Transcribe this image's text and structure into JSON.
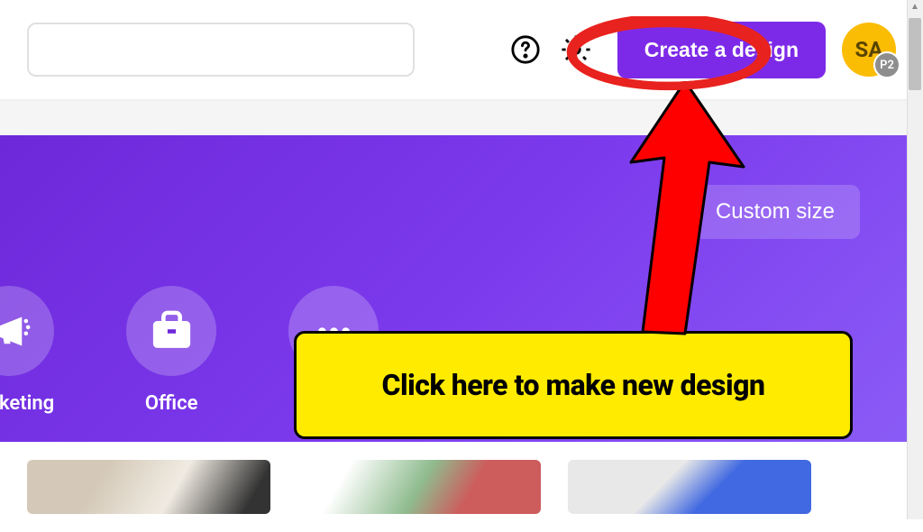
{
  "header": {
    "create_label": "Create a design",
    "avatar_initials": "SA",
    "avatar_badge": "P2"
  },
  "hero": {
    "custom_size_label": "Custom size",
    "categories": [
      {
        "label": "Marketing",
        "icon": "megaphone"
      },
      {
        "label": "Office",
        "icon": "briefcase"
      },
      {
        "label": "",
        "icon": "more"
      }
    ]
  },
  "annotation": {
    "callout_text": "Click here to make new design"
  }
}
